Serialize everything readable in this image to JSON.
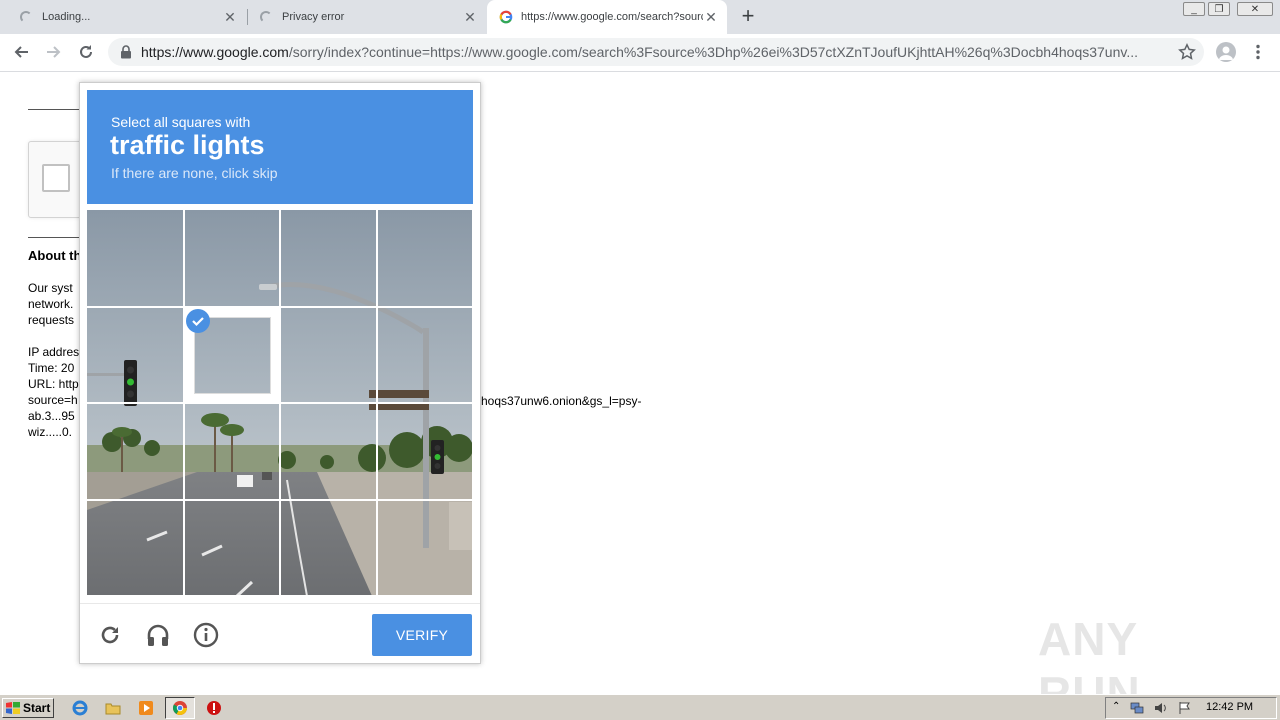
{
  "browser": {
    "tabs": [
      {
        "title": "Loading...",
        "state": "loading"
      },
      {
        "title": "Privacy error",
        "state": "loading"
      },
      {
        "title": "https://www.google.com/search?source=hp",
        "state": "active"
      }
    ],
    "new_tab_label": "+",
    "window_controls": {
      "minimize": "_",
      "restore": "❐",
      "close": "✕"
    },
    "url_host": "https://www.google.com",
    "url_path": "/sorry/index?continue=https://www.google.com/search%3Fsource%3Dhp%26ei%3D57ctXZnTJoufUKjhttAH%26q%3Docbh4hoqs37unv..."
  },
  "page": {
    "about_heading": "About th",
    "para1": [
      "Our syst",
      "network.",
      "requests"
    ],
    "para2": [
      "IP addres",
      "Time: 20",
      "URL: http",
      "source=h",
      "ab.3...95",
      "wiz.....0."
    ],
    "trailing_url": "hoqs37unw6.onion&gs_l=psy-"
  },
  "challenge": {
    "prompt_pre": "Select all squares with",
    "prompt_object": "traffic lights",
    "prompt_sub": "If there are none, click skip",
    "grid_rows": 4,
    "grid_cols": 4,
    "selected_tiles": [
      5
    ],
    "verify_label": "VERIFY",
    "header_color": "#4a90e2",
    "accent": "#4a90e2"
  },
  "watermark": "ANY RUN",
  "taskbar": {
    "start_label": "Start",
    "clock": "12:42 PM"
  }
}
